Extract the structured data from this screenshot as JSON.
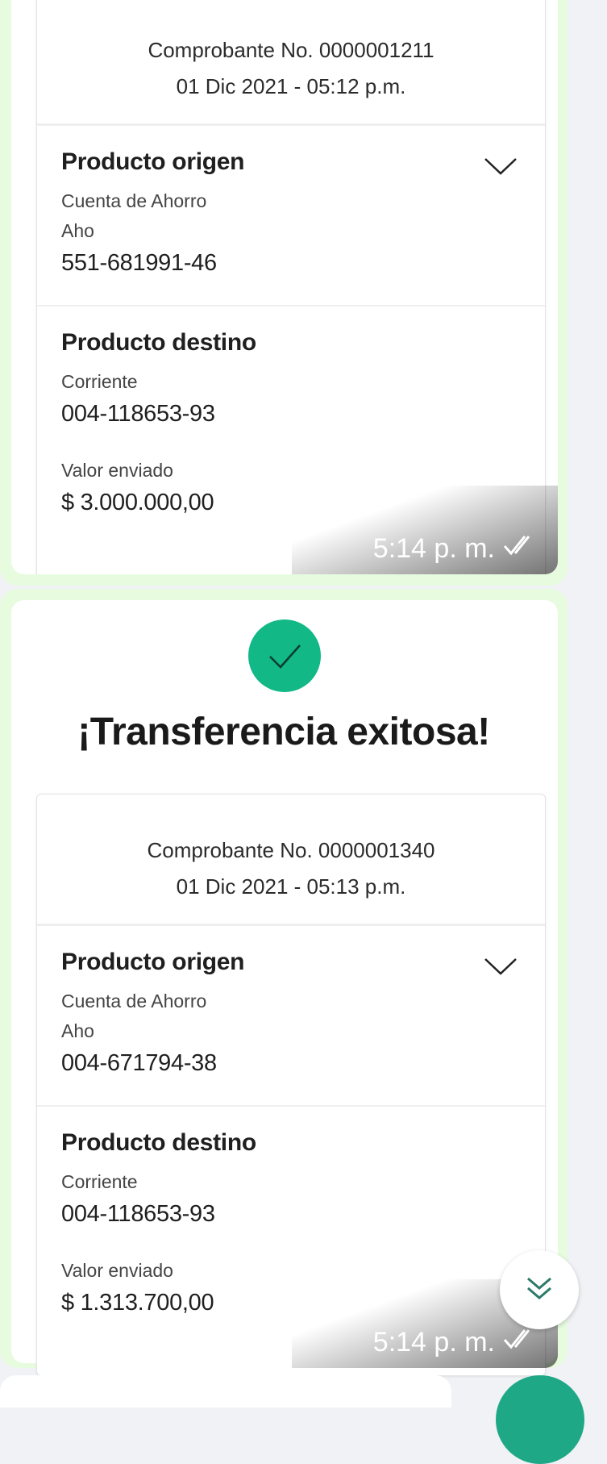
{
  "messages": [
    {
      "receipt": {
        "number": "Comprobante No. 0000001211",
        "date": "01 Dic 2021 - 05:12 p.m.",
        "origin": {
          "title": "Producto origen",
          "type": "Cuenta de Ahorro",
          "abbr": "Aho",
          "account": "551-681991-46"
        },
        "destination": {
          "title": "Producto destino",
          "type": "Corriente",
          "account": "004-118653-93"
        },
        "amount_label": "Valor enviado",
        "amount": "$ 3.000.000,00"
      },
      "time": "5:14 p. m."
    },
    {
      "success_title": "¡Transferencia exitosa!",
      "receipt": {
        "number": "Comprobante No. 0000001340",
        "date": "01 Dic 2021 - 05:13 p.m.",
        "origin": {
          "title": "Producto origen",
          "type": "Cuenta de Ahorro",
          "abbr": "Aho",
          "account": "004-671794-38"
        },
        "destination": {
          "title": "Producto destino",
          "type": "Corriente",
          "account": "004-118653-93"
        },
        "amount_label": "Valor enviado",
        "amount": "$ 1.313.700,00"
      },
      "time": "5:14 p. m."
    }
  ],
  "icons": {
    "success": "check-circle-icon",
    "expand": "chevron-down-icon",
    "read": "double-check-icon",
    "scroll": "double-chevron-down-icon"
  },
  "colors": {
    "bubble": "#e7fbdf",
    "success": "#12b886",
    "background": "#f0f2f5",
    "mic": "#1fa886"
  }
}
